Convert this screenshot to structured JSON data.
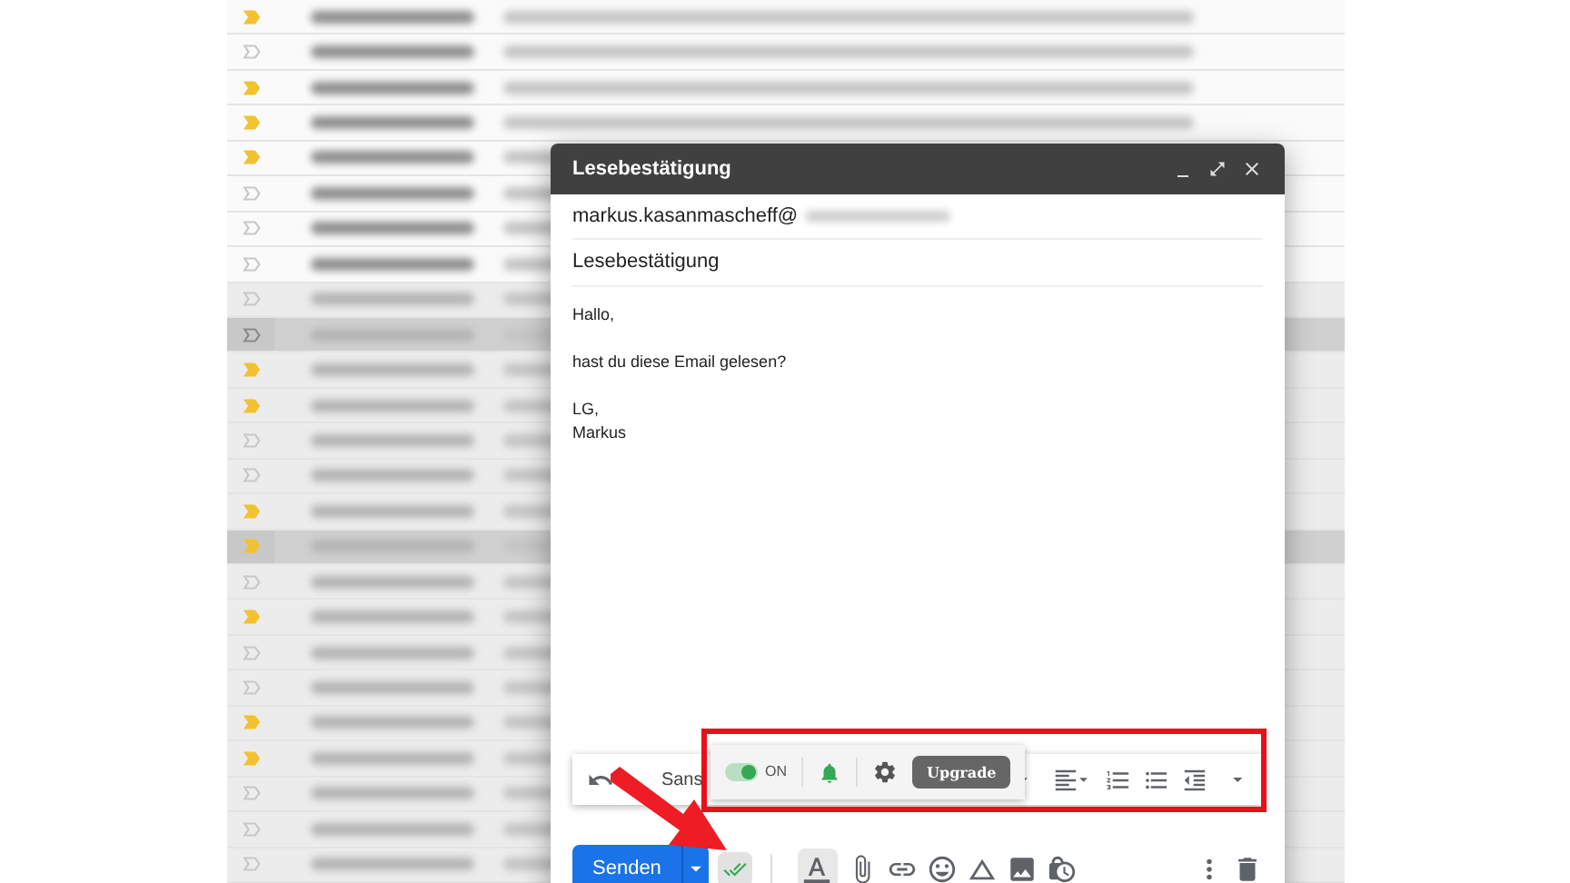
{
  "inbox": {
    "rows": [
      {
        "important": true,
        "selected": false,
        "read": false
      },
      {
        "important": false,
        "selected": false,
        "read": false
      },
      {
        "important": true,
        "selected": false,
        "read": false
      },
      {
        "important": true,
        "selected": false,
        "read": false
      },
      {
        "important": true,
        "selected": false,
        "read": false
      },
      {
        "important": false,
        "selected": false,
        "read": false
      },
      {
        "important": false,
        "selected": false,
        "read": false
      },
      {
        "important": false,
        "selected": false,
        "read": false
      },
      {
        "important": false,
        "selected": false,
        "read": true
      },
      {
        "important": false,
        "selected": true,
        "read": true
      },
      {
        "important": true,
        "selected": false,
        "read": true
      },
      {
        "important": true,
        "selected": false,
        "read": true
      },
      {
        "important": false,
        "selected": false,
        "read": true
      },
      {
        "important": false,
        "selected": false,
        "read": true
      },
      {
        "important": true,
        "selected": false,
        "read": true
      },
      {
        "important": true,
        "selected": true,
        "read": true
      },
      {
        "important": false,
        "selected": false,
        "read": true
      },
      {
        "important": true,
        "selected": false,
        "read": true
      },
      {
        "important": false,
        "selected": false,
        "read": true
      },
      {
        "important": false,
        "selected": false,
        "read": true
      },
      {
        "important": true,
        "selected": false,
        "read": true
      },
      {
        "important": true,
        "selected": false,
        "read": true
      },
      {
        "important": false,
        "selected": false,
        "read": true
      },
      {
        "important": false,
        "selected": false,
        "read": true
      },
      {
        "important": false,
        "selected": false,
        "read": true
      }
    ]
  },
  "compose": {
    "title": "Lesebestätigung",
    "to": "markus.kasanmascheff@",
    "subject": "Lesebestätigung",
    "body": [
      "Hallo,",
      "hast du diese Email gelesen?",
      "LG,\nMarkus"
    ]
  },
  "toolbar": {
    "font": "Sans"
  },
  "extension": {
    "toggle": {
      "on": true,
      "label": "ON"
    },
    "upgrade": "Upgrade"
  },
  "send": {
    "label": "Senden"
  },
  "read_receipt": {
    "on": true
  }
}
